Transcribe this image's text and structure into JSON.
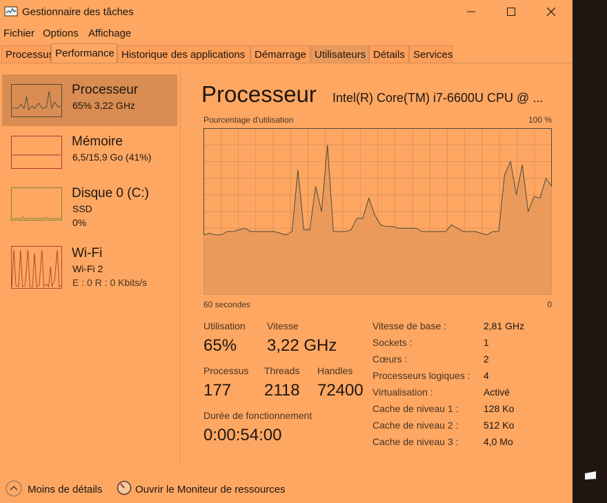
{
  "window": {
    "title": "Gestionnaire des tâches"
  },
  "menu": [
    "Fichier",
    "Options",
    "Affichage"
  ],
  "tabs": [
    "Processus",
    "Performance",
    "Historique des applications",
    "Démarrage",
    "Utilisateurs",
    "Détails",
    "Services"
  ],
  "active_tab": "Performance",
  "sidebar": {
    "items": [
      {
        "title": "Processeur",
        "sub1": "65%  3,22 GHz",
        "sub2": "",
        "thumb_color": "#4b4a3c"
      },
      {
        "title": "Mémoire",
        "sub1": "6,5/15,9 Go (41%)",
        "sub2": "",
        "thumb_color": "#b3343a"
      },
      {
        "title": "Disque 0 (C:)",
        "sub1": "SSD",
        "sub2": "0%",
        "thumb_color": "#7a8a2a"
      },
      {
        "title": "Wi-Fi",
        "sub1": "Wi-Fi 2",
        "sub2": "E : 0  R : 0 Kbits/s",
        "thumb_color": "#b5452a"
      }
    ],
    "selected": 0
  },
  "main": {
    "title": "Processeur",
    "cpu_model": "Intel(R) Core(TM) i7-6600U CPU @ ...",
    "graph_label": "Pourcentage d'utilisation",
    "graph_max": "100 %",
    "graph_time": "60 secondes",
    "graph_zero": "0",
    "stats": {
      "utilisation_label": "Utilisation",
      "utilisation": "65%",
      "vitesse_label": "Vitesse",
      "vitesse": "3,22 GHz",
      "processus_label": "Processus",
      "processus": "177",
      "threads_label": "Threads",
      "threads": "2118",
      "handles_label": "Handles",
      "handles": "72400",
      "uptime_label": "Durée de fonctionnement",
      "uptime": "0:00:54:00"
    },
    "properties": [
      {
        "label": "Vitesse de base :",
        "value": "2,81 GHz"
      },
      {
        "label": "Sockets :",
        "value": "1"
      },
      {
        "label": "Cœurs :",
        "value": "2"
      },
      {
        "label": "Processeurs logiques :",
        "value": "4"
      },
      {
        "label": "Virtualisation :",
        "value": "Activé"
      },
      {
        "label": "Cache de niveau 1 :",
        "value": "128 Ko"
      },
      {
        "label": "Cache de niveau 2 :",
        "value": "512 Ko"
      },
      {
        "label": "Cache de niveau 3 :",
        "value": "4,0 Mo"
      }
    ]
  },
  "footer": {
    "less_details": "Moins de détails",
    "resource_monitor": "Ouvrir le Moniteur de ressources"
  },
  "colors": {
    "window_bg": "#fda762",
    "graph_line": "#4b4a3c",
    "graph_fill": "#e89a5c"
  },
  "chart_data": {
    "type": "area",
    "ylim": [
      0,
      100
    ],
    "values": [
      36,
      37,
      36,
      36,
      38,
      38,
      39,
      40,
      38,
      38,
      38,
      38,
      38,
      37,
      36,
      38,
      75,
      39,
      39,
      65,
      50,
      90,
      38,
      38,
      38,
      39,
      46,
      46,
      58,
      48,
      42,
      41,
      41,
      40,
      40,
      40,
      40,
      38,
      38,
      38,
      38,
      38,
      42,
      40,
      38,
      38,
      38,
      37,
      36,
      38,
      38,
      72,
      80,
      60,
      78,
      50,
      59,
      58,
      70,
      65
    ]
  }
}
